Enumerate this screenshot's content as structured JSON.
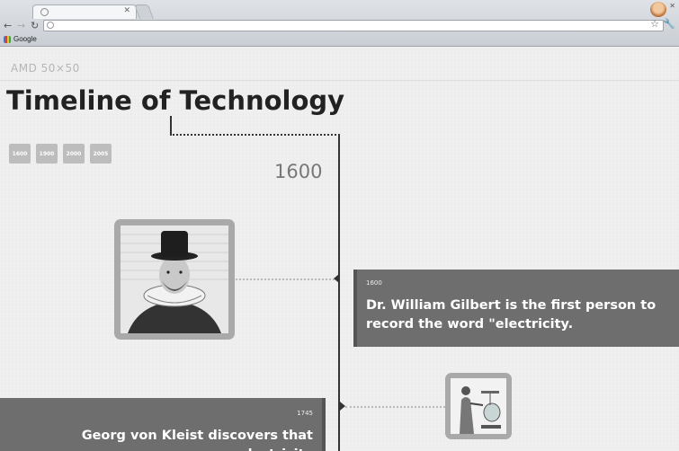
{
  "browser": {
    "tab_title": "",
    "url": "",
    "bookmarks": [
      {
        "label": "Google",
        "icon": "google-icon"
      }
    ],
    "icons": {
      "back": "back-arrow-icon",
      "forward": "forward-arrow-icon",
      "reload": "reload-icon",
      "star": "bookmark-star-icon",
      "wrench": "wrench-menu-icon",
      "profile": "profile-avatar-icon"
    }
  },
  "header": {
    "site_label": "AMD 50×50"
  },
  "page": {
    "title": "Timeline of Technology",
    "year_buttons": [
      "1600",
      "1900",
      "2000",
      "2005"
    ],
    "current_year": "1600"
  },
  "events": [
    {
      "year": "1600",
      "text": "Dr. William Gilbert is the first person to record the word \"electricity.",
      "image": "portrait-william-gilbert"
    },
    {
      "year": "1745",
      "text": "Georg von Kleist discovers that electricity",
      "image": "illustration-leyden-jar"
    }
  ],
  "colors": {
    "card_background": "#6e6e6e",
    "frame": "#a9a9a9",
    "spine": "#333333",
    "page_background": "#efefef"
  }
}
